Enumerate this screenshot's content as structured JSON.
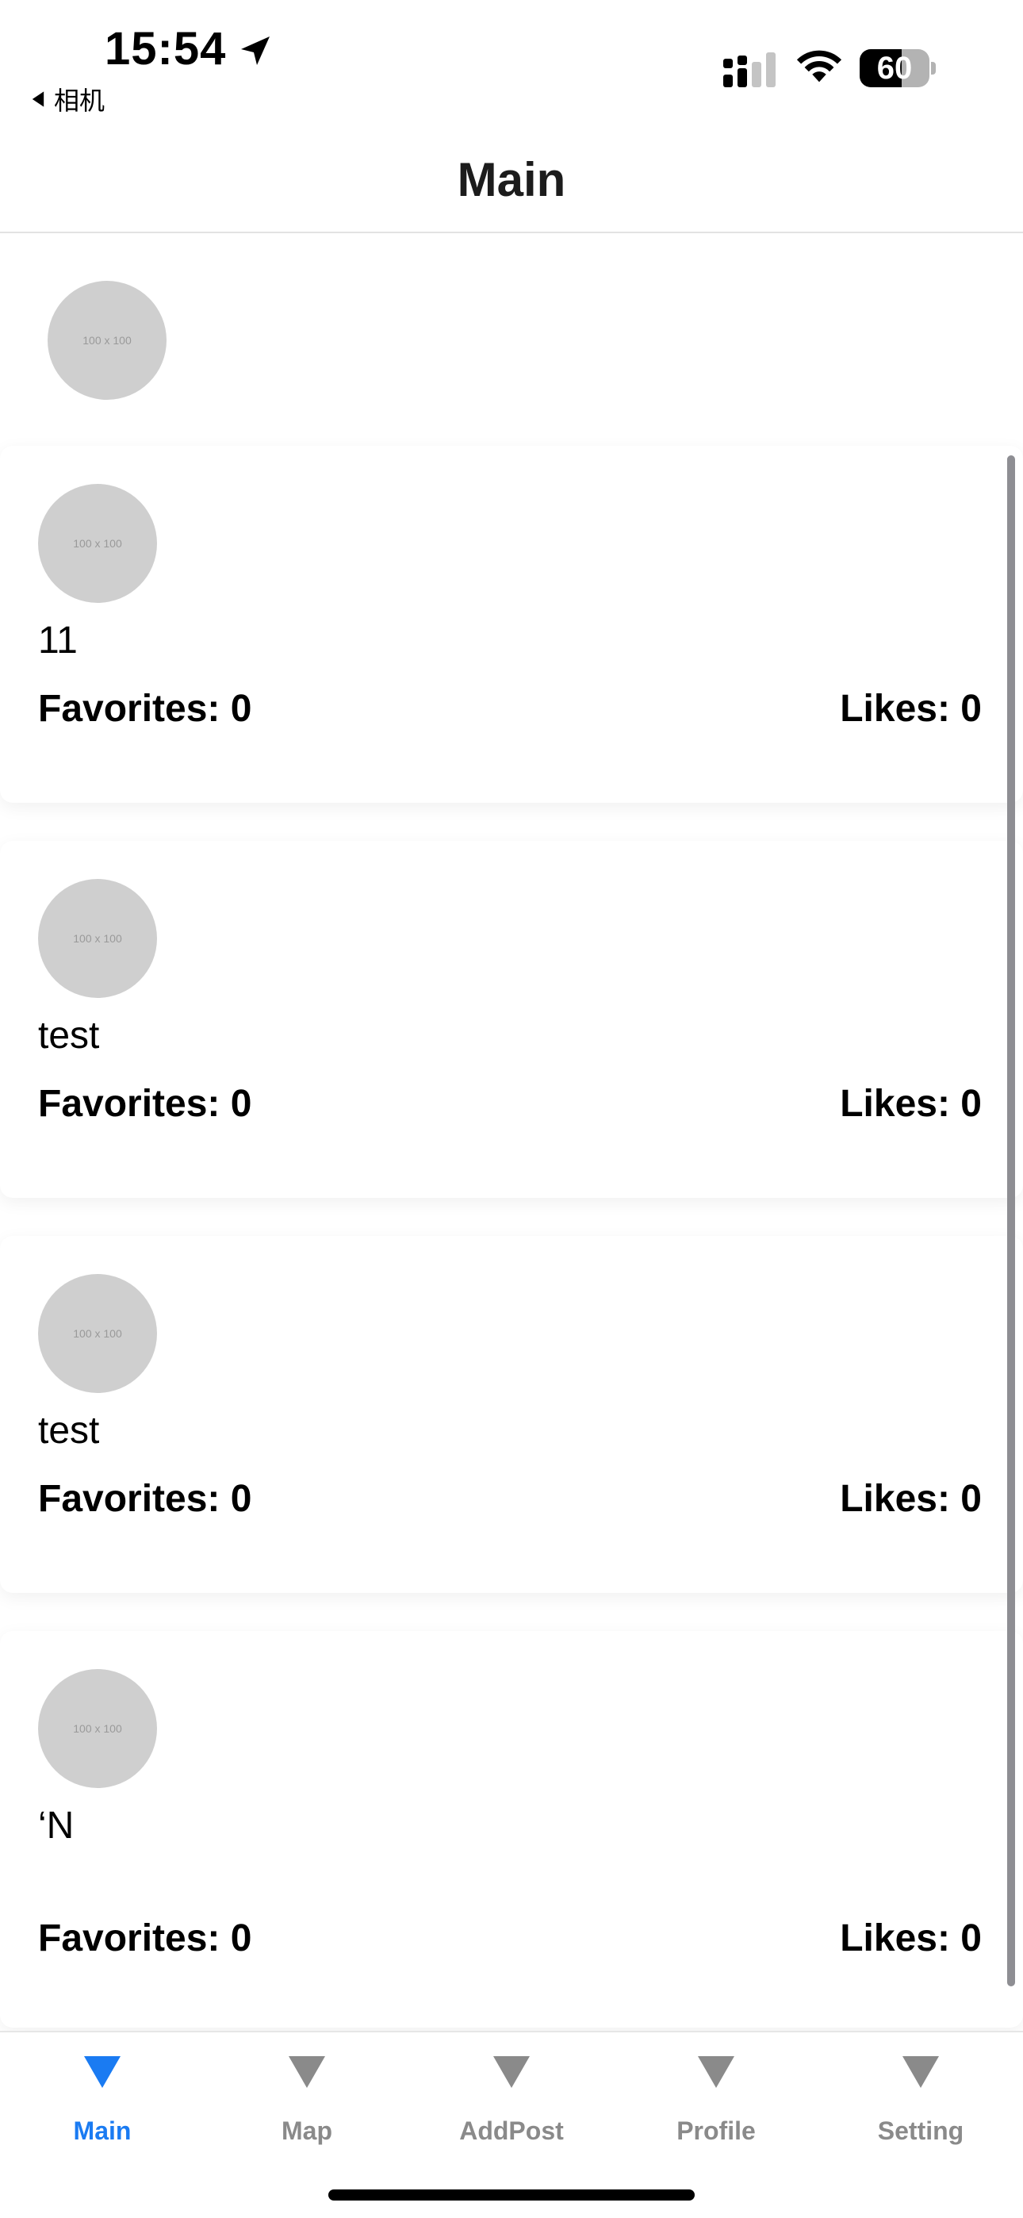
{
  "status_bar": {
    "time": "15:54",
    "back_app": "相机",
    "battery": "60"
  },
  "header": {
    "title": "Main"
  },
  "placeholder_text": "100 x 100",
  "feed": [
    {
      "title": "11",
      "favorites": "Favorites: 0",
      "likes": "Likes: 0"
    },
    {
      "title": "test",
      "favorites": "Favorites: 0",
      "likes": "Likes: 0"
    },
    {
      "title": "test",
      "favorites": "Favorites: 0",
      "likes": "Likes: 0"
    },
    {
      "title": "‘N",
      "favorites": "Favorites: 0",
      "likes": "Likes: 0"
    }
  ],
  "tabs": [
    {
      "label": "Main",
      "icon": "down-triangle-icon",
      "active": true
    },
    {
      "label": "Map",
      "icon": "down-triangle-icon",
      "active": false
    },
    {
      "label": "AddPost",
      "icon": "down-triangle-icon",
      "active": false
    },
    {
      "label": "Profile",
      "icon": "down-triangle-icon",
      "active": false
    },
    {
      "label": "Setting",
      "icon": "down-triangle-icon",
      "active": false
    }
  ],
  "colors": {
    "accent": "#1a7bf2",
    "inactive": "#8a8a8a",
    "placeholder": "#cfcfcf"
  }
}
